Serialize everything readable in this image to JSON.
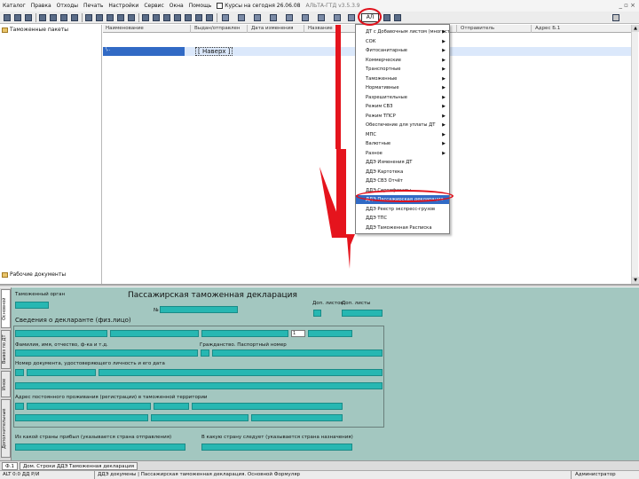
{
  "menubar": {
    "items": [
      "Каталог",
      "Правка",
      "Отходы",
      "Печать",
      "Настройки",
      "Сервис",
      "Окна",
      "Помощь"
    ],
    "checkbox_label": "Курсы на сегодня 26.06.08",
    "version": "АЛЬТА-ГТД  v3.5.3.9"
  },
  "toolbar": {
    "active_label": "АЛ"
  },
  "tree": {
    "root_label": "Таможенные пакеты",
    "bottom_label": "Рабочие документы"
  },
  "grid": {
    "columns": [
      "Наименование",
      "Выдан/отправлен",
      "Дата изменения",
      "Название",
      "Отправитель",
      "Адрес Б.1"
    ],
    "selected_row_label": "\\..",
    "up_label": "[ Наверх ]"
  },
  "dropdown": {
    "items": [
      {
        "label": "ДТ с Добавочным листом (многостраничная ДТ)",
        "submenu": true
      },
      {
        "label": "СОК",
        "submenu": true
      },
      {
        "label": "Фитосанитарные",
        "submenu": true
      },
      {
        "label": "Коммерческие",
        "submenu": true
      },
      {
        "label": "Транспортные",
        "submenu": true
      },
      {
        "label": "Таможенные",
        "submenu": true
      },
      {
        "label": "Нормативные",
        "submenu": true
      },
      {
        "label": "Разрешительные",
        "submenu": true
      },
      {
        "label": "Режим СВЗ",
        "submenu": true
      },
      {
        "label": "Режим ТПСР",
        "submenu": true
      },
      {
        "label": "Обеспечение для уплаты ДТ",
        "submenu": true
      },
      {
        "label": "МПС",
        "submenu": true
      },
      {
        "label": "Валютные",
        "submenu": true
      },
      {
        "label": "Разное",
        "submenu": true
      },
      {
        "label": "ДДЭ Изменения ДТ",
        "submenu": false
      },
      {
        "label": "ДДЭ Картотека",
        "submenu": false
      },
      {
        "label": "ДДЭ СВЗ Отчёт",
        "submenu": false
      },
      {
        "label": "ДДЭ Сертификаты",
        "submenu": false
      },
      {
        "label": "ДДЭ Пассажирская декларация",
        "submenu": false
      },
      {
        "label": "ДДЭ Реестр экспресс-грузов",
        "submenu": false
      },
      {
        "label": "ДДЭ ТПС",
        "submenu": false
      },
      {
        "label": "ДДЭ Таможенная Расписка",
        "submenu": false
      }
    ],
    "highlighted_index": 18
  },
  "form": {
    "title": "Пассажирская таможенная декларация",
    "customs_label": "Таможенный орган",
    "number_sign": "№",
    "additional_sheets": "Доп. листов",
    "extra_sheets_label": "Доп. листы",
    "declarant_section": "Сведения о декларанте (физ.лицо)",
    "name_label": "Фамилия, имя, отчество, ф-ка и т.д.",
    "passport_label": "Гражданство. Паспортный номер",
    "id_label": "Номер документа, удостоверяющего личность и его дата",
    "address_label": "Адрес постоянного проживания (регистрации) в таможенной территории",
    "country_from_label": "Из какой страны прибыл (указывается страна отправления)",
    "country_to_label": "В какую страну следует (указывается страна назначения)",
    "num_box": "1"
  },
  "vtabs": [
    "Основной",
    "Вывоз по ДТ",
    "Иное",
    "Дополнительные"
  ],
  "bottom_tabs": [
    "Ф.1",
    "Дом. Строки ДДЭ Таможенная декларация"
  ],
  "status": {
    "left": "ALT  0:0  ДД  Р/И",
    "middle": "ДДЭ докумены | Пассажирская таможенная декларация. Основной Формуляр",
    "right": "Администратор"
  }
}
